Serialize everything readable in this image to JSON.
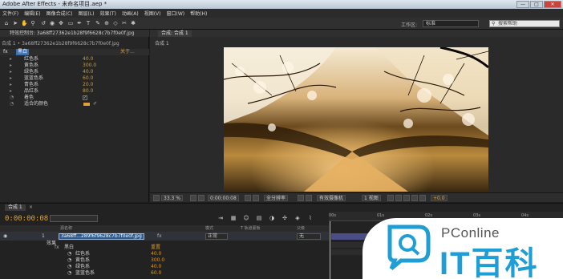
{
  "window": {
    "title": "Adobe After Effects - 未命名项目.aep *",
    "minimize": "—",
    "maximize": "□",
    "close": "✕"
  },
  "menu": [
    "文件(F)",
    "编辑(E)",
    "图像合成(C)",
    "图层(L)",
    "效果(T)",
    "动画(A)",
    "视图(V)",
    "窗口(W)",
    "帮助(H)"
  ],
  "toolbar": {
    "tools": [
      "home-icon",
      "selection-icon",
      "hand-icon",
      "zoom-icon",
      "rotate-icon",
      "camera-icon",
      "pan-icon",
      "rect-icon",
      "pen-icon",
      "text-icon",
      "brush-icon",
      "clone-icon",
      "eraser-icon",
      "roto-icon",
      "pin-icon"
    ],
    "workspace_label": "工作区:",
    "workspace_value": "标准",
    "search_placeholder": "搜索帮助"
  },
  "effect_controls": {
    "tab_label": "特效控制台: 3a68ff27362e1b28f9f6628c7b7f0e0f.jpg",
    "path": "合成 1 • 3a68ff27362e1b28f9f6628c7b7f0e0f.jpg",
    "effect_name": "黑白",
    "fx_label": "fx",
    "reset_label": "关于...",
    "params": [
      {
        "name": "红色系",
        "value": "40.0"
      },
      {
        "name": "黄色系",
        "value": "300.0"
      },
      {
        "name": "绿色系",
        "value": "40.0"
      },
      {
        "name": "蓝蓝色系",
        "value": "60.0"
      },
      {
        "name": "青色系",
        "value": "20.0"
      },
      {
        "name": "品红系",
        "value": "80.0"
      }
    ],
    "tint_label": "着色",
    "tint_color_label": "适合的颜色",
    "tint_color": "#e0a03a"
  },
  "composition": {
    "tab_label": "合成: 合成 1",
    "sub_label": "合成 1",
    "zoom": "33.3 %",
    "timecode": "0:00:00:08",
    "resolution": "全分辨率",
    "camera": "有效摄像机",
    "view": "1 视图",
    "exposure": "+0.0"
  },
  "timeline": {
    "tab_label": "合成 1",
    "timecode": "0:00:00:08",
    "ruler_ticks": [
      "00s",
      "01s",
      "02s",
      "03s",
      "04s"
    ],
    "col_source": "源名称",
    "col_mode": "模式",
    "col_trkmat": "T 轨道蒙板",
    "col_parent": "父级",
    "layer_index": "1",
    "layer_name": "3a68ff...289f6f9628c7b7f0e0f.jpg",
    "layer_mode": "正常",
    "layer_parent": "无",
    "effects_label": "效果",
    "effect_name": "黑白",
    "reset_label": "重置",
    "sub_params": [
      {
        "name": "红色系",
        "value": "40.0"
      },
      {
        "name": "黄色系",
        "value": "300.0"
      },
      {
        "name": "绿色系",
        "value": "40.0"
      },
      {
        "name": "蓝蓝色系",
        "value": "60.0"
      }
    ]
  },
  "watermark": {
    "brand": "PConline",
    "text": "IT百科"
  }
}
